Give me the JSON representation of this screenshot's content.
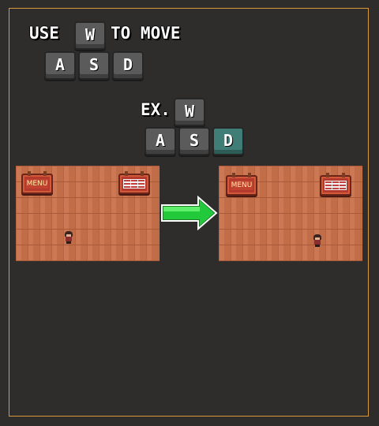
{
  "instruction": {
    "use_label": "USE",
    "to_move_label": "TO MOVE",
    "example_label": "EX."
  },
  "keys": {
    "w": "W",
    "a": "A",
    "s": "S",
    "d": "D"
  },
  "example_keys": {
    "w": "W",
    "a": "A",
    "s": "S",
    "d": "D",
    "pressed": "D"
  },
  "rooms": {
    "before": {
      "menu_sign": "MENU"
    },
    "after": {
      "menu_sign": "MENU"
    }
  },
  "colors": {
    "frame": "#d8993c",
    "background": "#2f2d2b",
    "key": "#5b5b5b",
    "key_pressed": "#3f7d76",
    "arrow": "#22c93a",
    "floor": "#c9714b"
  }
}
